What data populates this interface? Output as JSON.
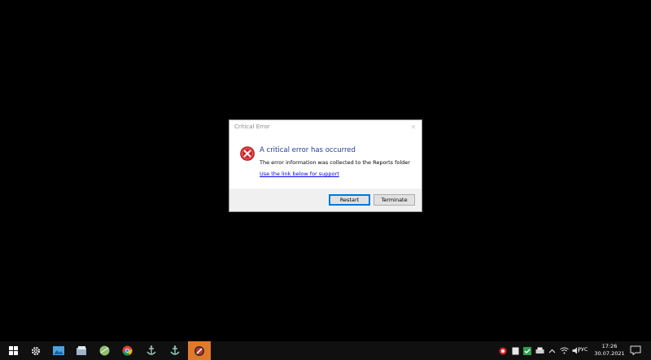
{
  "dialog": {
    "title": "Critical Error",
    "close_symbol": "✕",
    "main_instruction": "A critical error has occurred",
    "detail": "The error information was collected to the Reports folder",
    "link": "Use the link below for support",
    "buttons": {
      "restart": "Restart",
      "terminate": "Terminate"
    },
    "icon": "error-icon",
    "colors": {
      "instruction": "#1f3f9f",
      "link": "#0000ee",
      "error_red": "#d9262b"
    }
  },
  "taskbar": {
    "items": [
      {
        "name": "start-icon"
      },
      {
        "name": "settings-icon"
      },
      {
        "name": "photos-icon"
      },
      {
        "name": "file-manager-icon"
      },
      {
        "name": "app-globe-icon"
      },
      {
        "name": "chrome-icon"
      },
      {
        "name": "ship-anchor-icon"
      },
      {
        "name": "ship-anchor-icon-2"
      },
      {
        "name": "crash-app-icon",
        "active": true
      }
    ],
    "tray": {
      "language": "РУС",
      "time": "17:26",
      "date": "30.07.2021"
    },
    "active_color": "#e07a2a"
  }
}
